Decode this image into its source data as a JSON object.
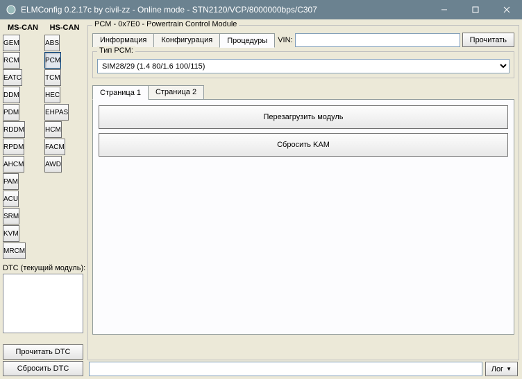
{
  "window": {
    "title": "ELMConfig 0.2.17c by civil-zz - Online mode - STN2120/VCP/8000000bps/C307"
  },
  "columns": {
    "ms_can_header": "MS-CAN",
    "hs_can_header": "HS-CAN",
    "ms_can": [
      "GEM",
      "RCM",
      "EATC",
      "DDM",
      "PDM",
      "RDDM",
      "RPDM",
      "AHCM",
      "PAM",
      "ACU",
      "SRM",
      "KVM",
      "MRCM"
    ],
    "hs_can": [
      "ABS",
      "PCM",
      "TCM",
      "HEC",
      "EHPAS",
      "HCM",
      "FACM",
      "AWD"
    ]
  },
  "dtc": {
    "label": "DTC (текущий модуль):",
    "read": "Прочитать DTC",
    "reset": "Сбросить DTC"
  },
  "pcm": {
    "group_title": "PCM - 0x7E0 - Powertrain Control Module",
    "tabs": {
      "info": "Информация",
      "config": "Конфигурация",
      "procedures": "Процедуры"
    },
    "vin_label": "VIN:",
    "vin_value": "",
    "read_btn": "Прочитать",
    "type_group": "Тип PCM:",
    "type_selected": "SIM28/29 (1.4 80/1.6 100/115)",
    "inner_tabs": {
      "page1": "Страница 1",
      "page2": "Страница 2"
    },
    "actions": {
      "reload": "Перезагрузить модуль",
      "reset_kam": "Сбросить KAM"
    }
  },
  "log": {
    "btn": "Лог"
  }
}
